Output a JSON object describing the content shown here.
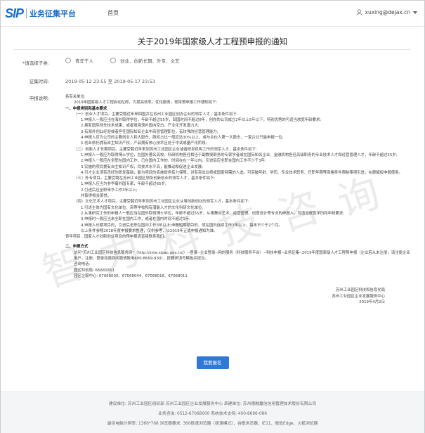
{
  "header": {
    "logo_mark": "SIP",
    "logo_text": "业务征集平台",
    "nav_home": "首页",
    "user_email": "xuxing@dejax.cn"
  },
  "notice": {
    "title": "关于2019年国家级人才工程预申报的通知"
  },
  "form": {
    "type_label": "*请选择子类:",
    "type_options": [
      "青年千人",
      "创业、创新长期、外专、文艺"
    ],
    "time_label": "征集时间:",
    "time_value": "2019-05-12 23:55 至 2019-05-17 23:53",
    "desc_label": "申报说明:"
  },
  "body": {
    "greeting": "各有关单位:",
    "intro": "2019年国家级人才工程启动在即，为提高效率，优化服务，现将预申报工作通知如下:",
    "s1_title": "一、申报类别和基本要求",
    "s1_1": "（一）创业人才项目。主要受聘近年来回国并在苏州工业园区创办企业的领军人才，基本条件如下:",
    "s1_1_a": "1.申报人一般应当在海外取得学位，年龄不超过55岁，回国时间不超过8年，创办的公司成立2年以上5年以下，特别优秀的可适当放宽年龄要求;",
    "s1_1_b": "2.拥有国际领先技术成果，或者填海领补国内空白，产业化开发潜力大;",
    "s1_1_c": "3.有海外创业经验或者担任国际知名企业中高层管理职位，有较强的经营管理能力;",
    "s1_1_d": "4.申报人应为公司的主要创业人和大股东，股权占比一般应达30%以上，或与合伙人第一大股东，一家企业只能申报一位;",
    "s1_1_e": "5.创业依托拥有自主知识产权，产品拥有核心技术且处于中试或量产化阶段。",
    "s1_2": "（二）创新人才长期项目。主要受聘近年来到苏州工业园区企业或者研发机构工作的领军人才，基本条件如下:",
    "s1_2_a": "1.申报人一般应为取得博士学位，在国外著名高校、科研机构担任相当于副教授职务的专家学者或在国际知名企业、金融机构担任高级职务的专业技术人才和经营管理人才，年龄不超过55岁;",
    "s1_2_b": "2.申报人一般应在全职在国内工作，已在国内工作的，时间在在一年以内，引进后应全职在国内工作不少于3年;",
    "s1_2_c": "3.实施的项目拥有自主知识产权，目技术水平高，能推动和促进企业发展;",
    "s1_2_d": "4.引才企业须有良好的研发基础，能为项目的实施提供有力保障，对有突出业绩或国家特需的人选，可突破年龄、学历、专业技术职务、任职年限等资格条件限制事项引进，在顾赋权申报使用。",
    "s1_3": "（三）外专项目。主要受聘在苏州工业园区领衔创新创业的领军人才，基本条件如下:",
    "s1_3_a": "1.申报人应当为非华裔外国专家，年龄不超过65岁;",
    "s1_3_b": "2.引进后应全职来华工作3年以上;",
    "s1_3_c": "并取得相关荣誉。",
    "s1_4": "（四）文化艺术人才项目。主要受聘近年来到苏州工业园区企业从事创新创业的领军人才，基本条件如下:",
    "s1_4_a": "1.引进主体为国有文化单位、高等学校和有潜能人才的文化科研文化单位;",
    "s1_4_b": "2.从事研究工作的申报人一般应当在国外取得博士学位，年龄不超过55岁，从事舞台艺术、经营管理、创意设计等专业的申报人，可适当放宽学历和年龄要求;",
    "s1_4_c": "3.申报时一般应当未全职在国内工作，或者在国内时间不超过1年;",
    "s1_4_d": "4.申报人长期项目的，引进后全职在国内工作3年以上;申报短期项目的，须在国内连续工作3年以上，每年不少于2个月。",
    "s1_note1": "以上条件参照2018年度申报要求整理，仅供参考，以2019年正式申报通知为准。",
    "s1_note2": "青年项目、国家人才创新创业项目的预申报请直接联系我们。",
    "s2_title": "二、申报方式",
    "s2_a": "访问\"苏州工业园区科技信息服务网\"（http://sme.sipac.gov.cn/）--登录--企业登录--网的服务（科技服务平台）--科技申报--业务征集--2019年度国家级人才工程预申报（企业若从未注册，请注册企业用户。注册、登录如遇到问题请致电400-8669-930），按要求填写模板并提交。",
    "s2_b": "咨询电话:",
    "s2_c": "园区科创局: 66681651",
    "s2_d": "园区企服中心: 67068000、67068044、67068016、67068011",
    "sign_1": "苏州工业园区科技和信息化局",
    "sign_2": "苏州工业园区企业发展服务中心",
    "sign_3": "2019年4月2日"
  },
  "watermark": [
    "智",
    "力",
    "科",
    "技",
    "咨",
    "询"
  ],
  "actions": {
    "submit_label": "我要报名"
  },
  "footer": {
    "line1": "建设单位: 苏州工业园区组织部 苏州工业园区企业发展服务中心    承建单位: 苏州德融嘉信信用管理技术股份有限公司",
    "line2": "业务咨询: 0512-67068000    系统技术支持: 400-8696-086",
    "line3": "最佳电脑分辨率: 1366*768    浏览器要求: 360极速浏览器（极速模式）、谷歌浏览器、IE11、微软Edge、火狐浏览器"
  },
  "colors": {
    "brand_blue": "#1a6fc9",
    "button_blue": "#2f78d6",
    "required_star": "#d9001b"
  }
}
